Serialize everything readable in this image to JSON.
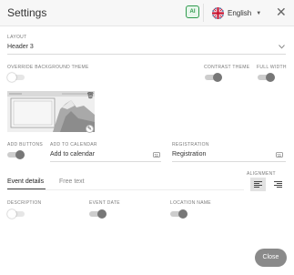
{
  "header": {
    "title": "Settings",
    "language": "English"
  },
  "layout": {
    "label": "LAYOUT",
    "value": "Header 3"
  },
  "background": {
    "override_label": "OVERRIDE BACKGROUND THEME",
    "override_on": false,
    "contrast_label": "CONTRAST THEME",
    "contrast_on": true,
    "fullwidth_label": "FULL WIDTH",
    "fullwidth_on": true
  },
  "options": {
    "add_buttons_label": "ADD BUTTONS",
    "add_buttons_on": true,
    "add_to_calendar_label": "ADD TO CALENDAR",
    "add_to_calendar_value": "Add to calendar",
    "registration_label": "REGISTRATION",
    "registration_value": "Registration"
  },
  "tabs": [
    {
      "label": "Event details",
      "active": true
    },
    {
      "label": "Free text",
      "active": false
    }
  ],
  "alignment": {
    "label": "ALIGNMENT",
    "selected": "left"
  },
  "details": {
    "description_label": "DESCRIPTION",
    "description_on": false,
    "event_date_label": "EVENT DATE",
    "event_date_on": true,
    "location_name_label": "LOCATION NAME",
    "location_name_on": true
  },
  "footer": {
    "close_label": "Close"
  },
  "colors": {
    "accent_green": "#2f9a4d",
    "toggle_on": "#777777",
    "close_button": "#8a8a8a"
  }
}
